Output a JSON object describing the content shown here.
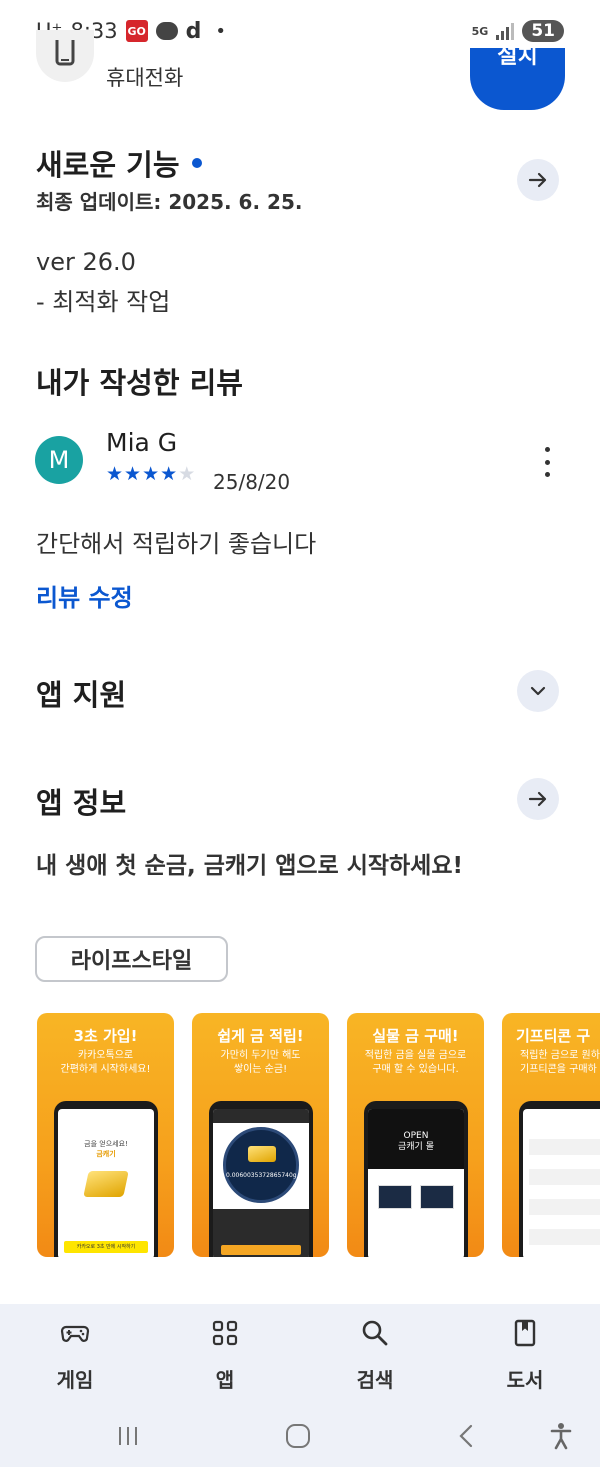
{
  "status_bar": {
    "carrier": "U⁺",
    "time": "8:33",
    "go_badge": "GO",
    "d_icon": "d",
    "dot": "•",
    "network": "5G",
    "battery": "51"
  },
  "top_partial": {
    "device_label": "휴대전화",
    "install_label": "설치"
  },
  "whats_new": {
    "title": "새로운 기능",
    "updated": "최종 업데이트: 2025. 6. 25.",
    "version": "ver 26.0",
    "notes": "- 최적화 작업"
  },
  "my_review": {
    "title": "내가 작성한 리뷰",
    "avatar_letter": "M",
    "reviewer": "Mia G",
    "rating": 4,
    "rating_max": 5,
    "date": "25/8/20",
    "text": "간단해서 적립하기 좋습니다",
    "edit_label": "리뷰 수정"
  },
  "app_support": {
    "title": "앱 지원"
  },
  "app_info": {
    "title": "앱 정보",
    "description": "내 생애 첫 순금, 금캐기 앱으로 시작하세요!",
    "category": "라이프스타일"
  },
  "screenshots": [
    {
      "title": "3초 가입!",
      "sub1": "카카오톡으로",
      "sub2": "간편하게 시작하세요!",
      "screen_line1": "금을 얻으세요!",
      "screen_line2": "금캐기",
      "screen_button": "카카오로 3초 만에 시작하기"
    },
    {
      "title": "쉽게 금 적립!",
      "sub1": "가만히 두기만 해도",
      "sub2": "쌓이는 순금!",
      "screen_value": "0.0060035372865740g"
    },
    {
      "title": "실물 금 구매!",
      "sub1": "적립한 금을 실물 금으로",
      "sub2": "구매 할 수 있습니다.",
      "screen_line1": "OPEN",
      "screen_line2": "금캐기 몰"
    },
    {
      "title": "기프티콘 구",
      "sub1": "적립한 금으로 원하",
      "sub2": "기프티콘을 구매하"
    }
  ],
  "bottom_nav": [
    {
      "label": "게임",
      "icon": "gamepad-icon"
    },
    {
      "label": "앱",
      "icon": "apps-grid-icon"
    },
    {
      "label": "검색",
      "icon": "search-icon"
    },
    {
      "label": "도서",
      "icon": "book-icon"
    }
  ],
  "colors": {
    "accent": "#0b57d0",
    "avatar": "#19a2a2",
    "round_button_bg": "#e8ecf5",
    "nav_bg": "#eef1f8"
  }
}
